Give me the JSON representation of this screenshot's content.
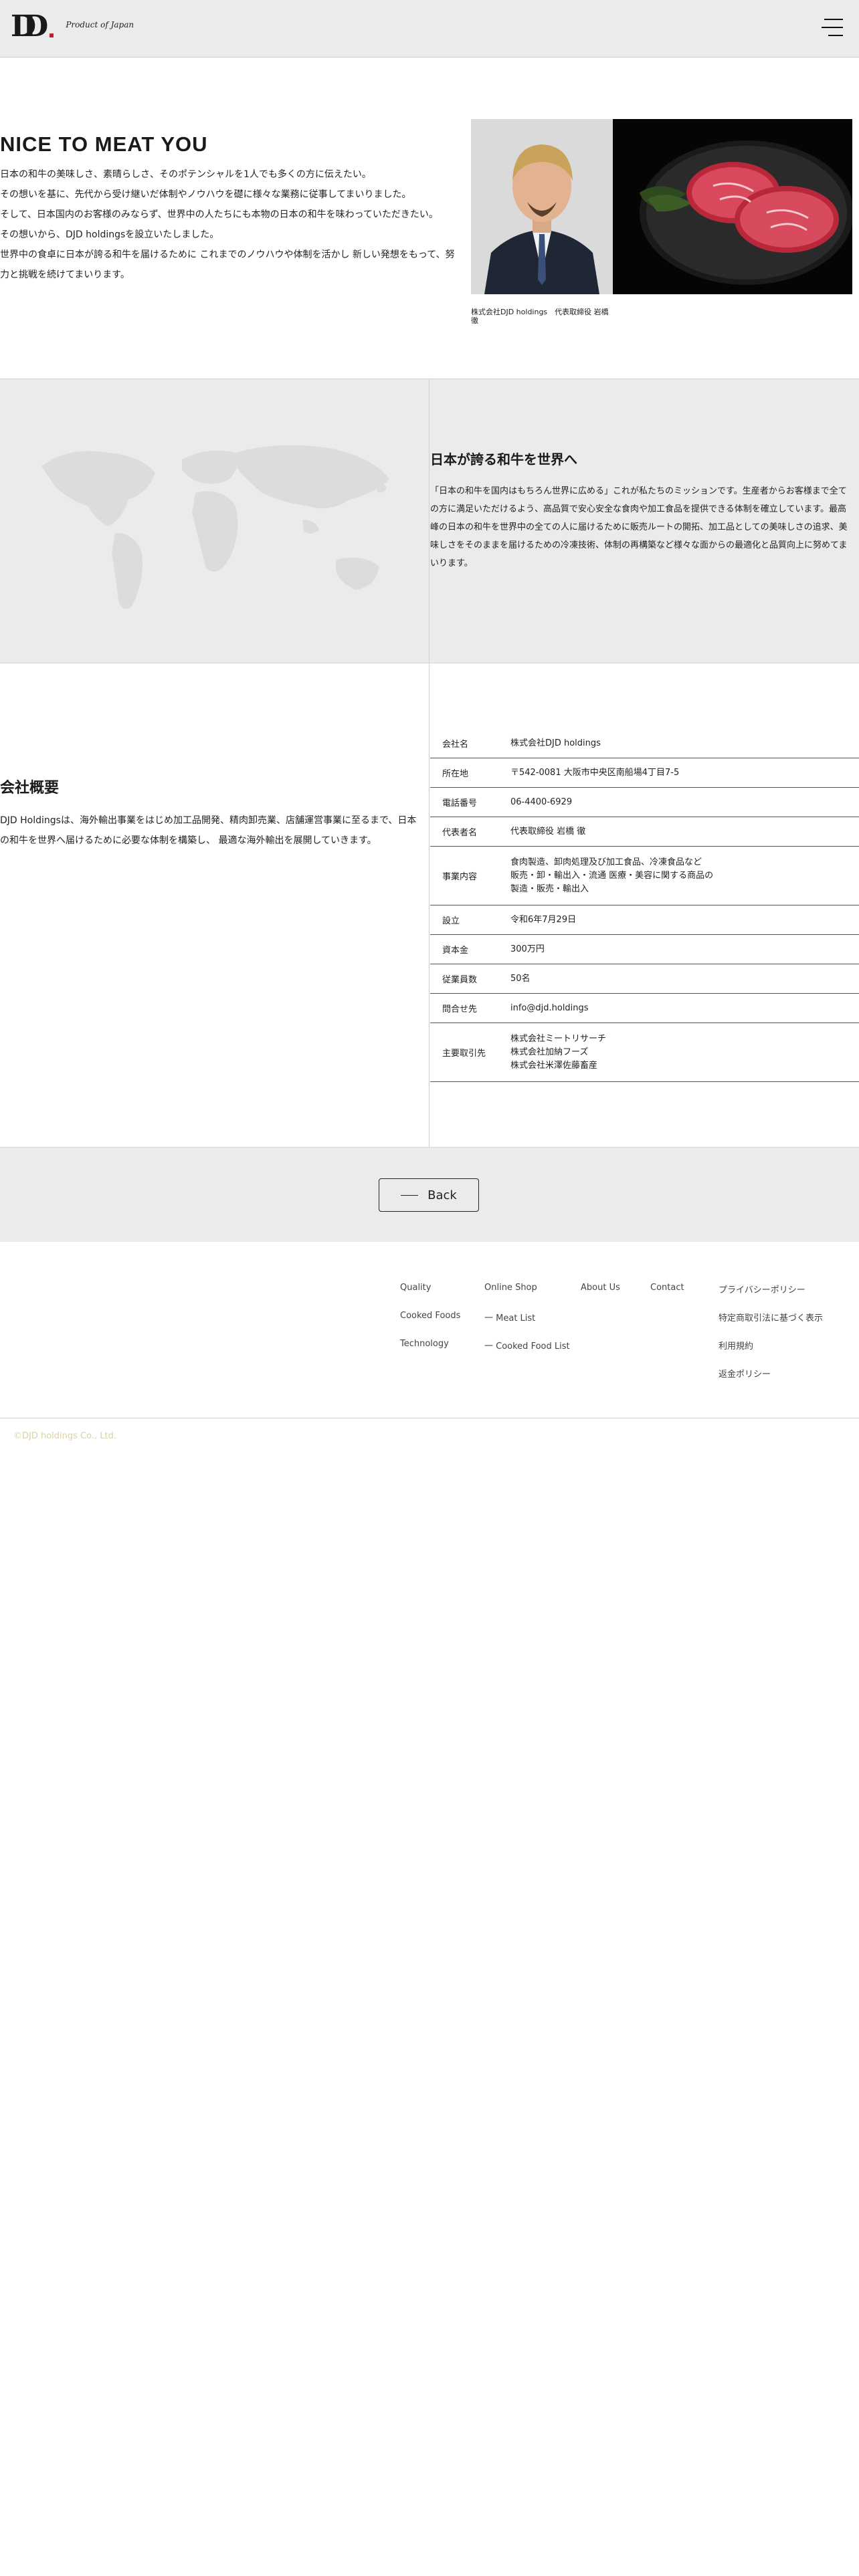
{
  "header": {
    "logo_mark": "D",
    "logo_tagline": "Product of Japan"
  },
  "intro": {
    "title": "NICE TO MEAT YOU",
    "paragraphs": [
      "日本の和牛の美味しさ、素晴らしさ、そのポテンシャルを1人でも多くの方に伝えたい。",
      "その想いを基に、先代から受け継いだ体制やノウハウを礎に様々な業務に従事してまいりました。",
      "そして、日本国内のお客様のみならず、世界中の人たちにも本物の日本の和牛を味わっていただきたい。",
      "その想いから、DJD holdingsを設立いたしました。",
      "世界中の食卓に日本が誇る和牛を届けるために これまでのノウハウや体制を活かし 新しい発想をもって、努力と挑戦を続けてまいります。"
    ],
    "photo_caption": "株式会社DJD holdings　代表取締役 岩橋　徹"
  },
  "mission": {
    "title": "日本が誇る和牛を世界へ",
    "text": "「日本の和牛を国内はもちろん世界に広める」これが私たちのミッションです。生産者からお客様まで全ての方に満足いただけるよう、高品質で安心安全な食肉や加工食品を提供できる体制を確立しています。最高峰の日本の和牛を世界中の全ての人に届けるために販売ルートの開拓、加工品としての美味しさの追求、美味しさをそのままを届けるための冷凍技術、体制の再構築など様々な面からの最適化と品質向上に努めてまいります。"
  },
  "company": {
    "title": "会社概要",
    "text": "DJD Holdingsは、海外輸出事業をはじめ加工品開発、精肉卸売業、店舗運営事業に至るまで、日本の和牛を世界へ届けるために必要な体制を構築し、 最適な海外輸出を展開していきます。",
    "rows": [
      {
        "label": "会社名",
        "value": "株式会社DJD holdings"
      },
      {
        "label": "所在地",
        "value": "〒542-0081 大阪市中央区南船場4丁目7-5"
      },
      {
        "label": "電話番号",
        "value": "06-4400-6929"
      },
      {
        "label": "代表者名",
        "value": "代表取締役 岩橋 徹"
      },
      {
        "label": "事業内容",
        "value": "食肉製造、卸肉処理及び加工食品、冷凍食品など\n販売・卸・輸出入・流通 医療・美容に関する商品の\n製造・販売・輸出入"
      },
      {
        "label": "設立",
        "value": "令和6年7月29日"
      },
      {
        "label": "資本金",
        "value": "300万円"
      },
      {
        "label": "従業員数",
        "value": "50名"
      },
      {
        "label": "問合せ先",
        "value": "info@djd.holdings"
      },
      {
        "label": "主要取引先",
        "value": "株式会社ミートリサーチ\n株式会社加納フーズ\n株式会社米澤佐藤畜産"
      }
    ]
  },
  "back": {
    "label": "Back"
  },
  "footer": {
    "col1": [
      "Quality",
      "Cooked Foods",
      "Technology"
    ],
    "col2": [
      "Online Shop",
      "一 Meat List",
      "一 Cooked Food List"
    ],
    "col3": [
      "About Us"
    ],
    "col4": [
      "Contact"
    ],
    "col5": [
      "プライバシーポリシー",
      "特定商取引法に基づく表示",
      "利用規約",
      "返金ポリシー"
    ],
    "copyright": "©DJD holdings Co., Ltd."
  }
}
